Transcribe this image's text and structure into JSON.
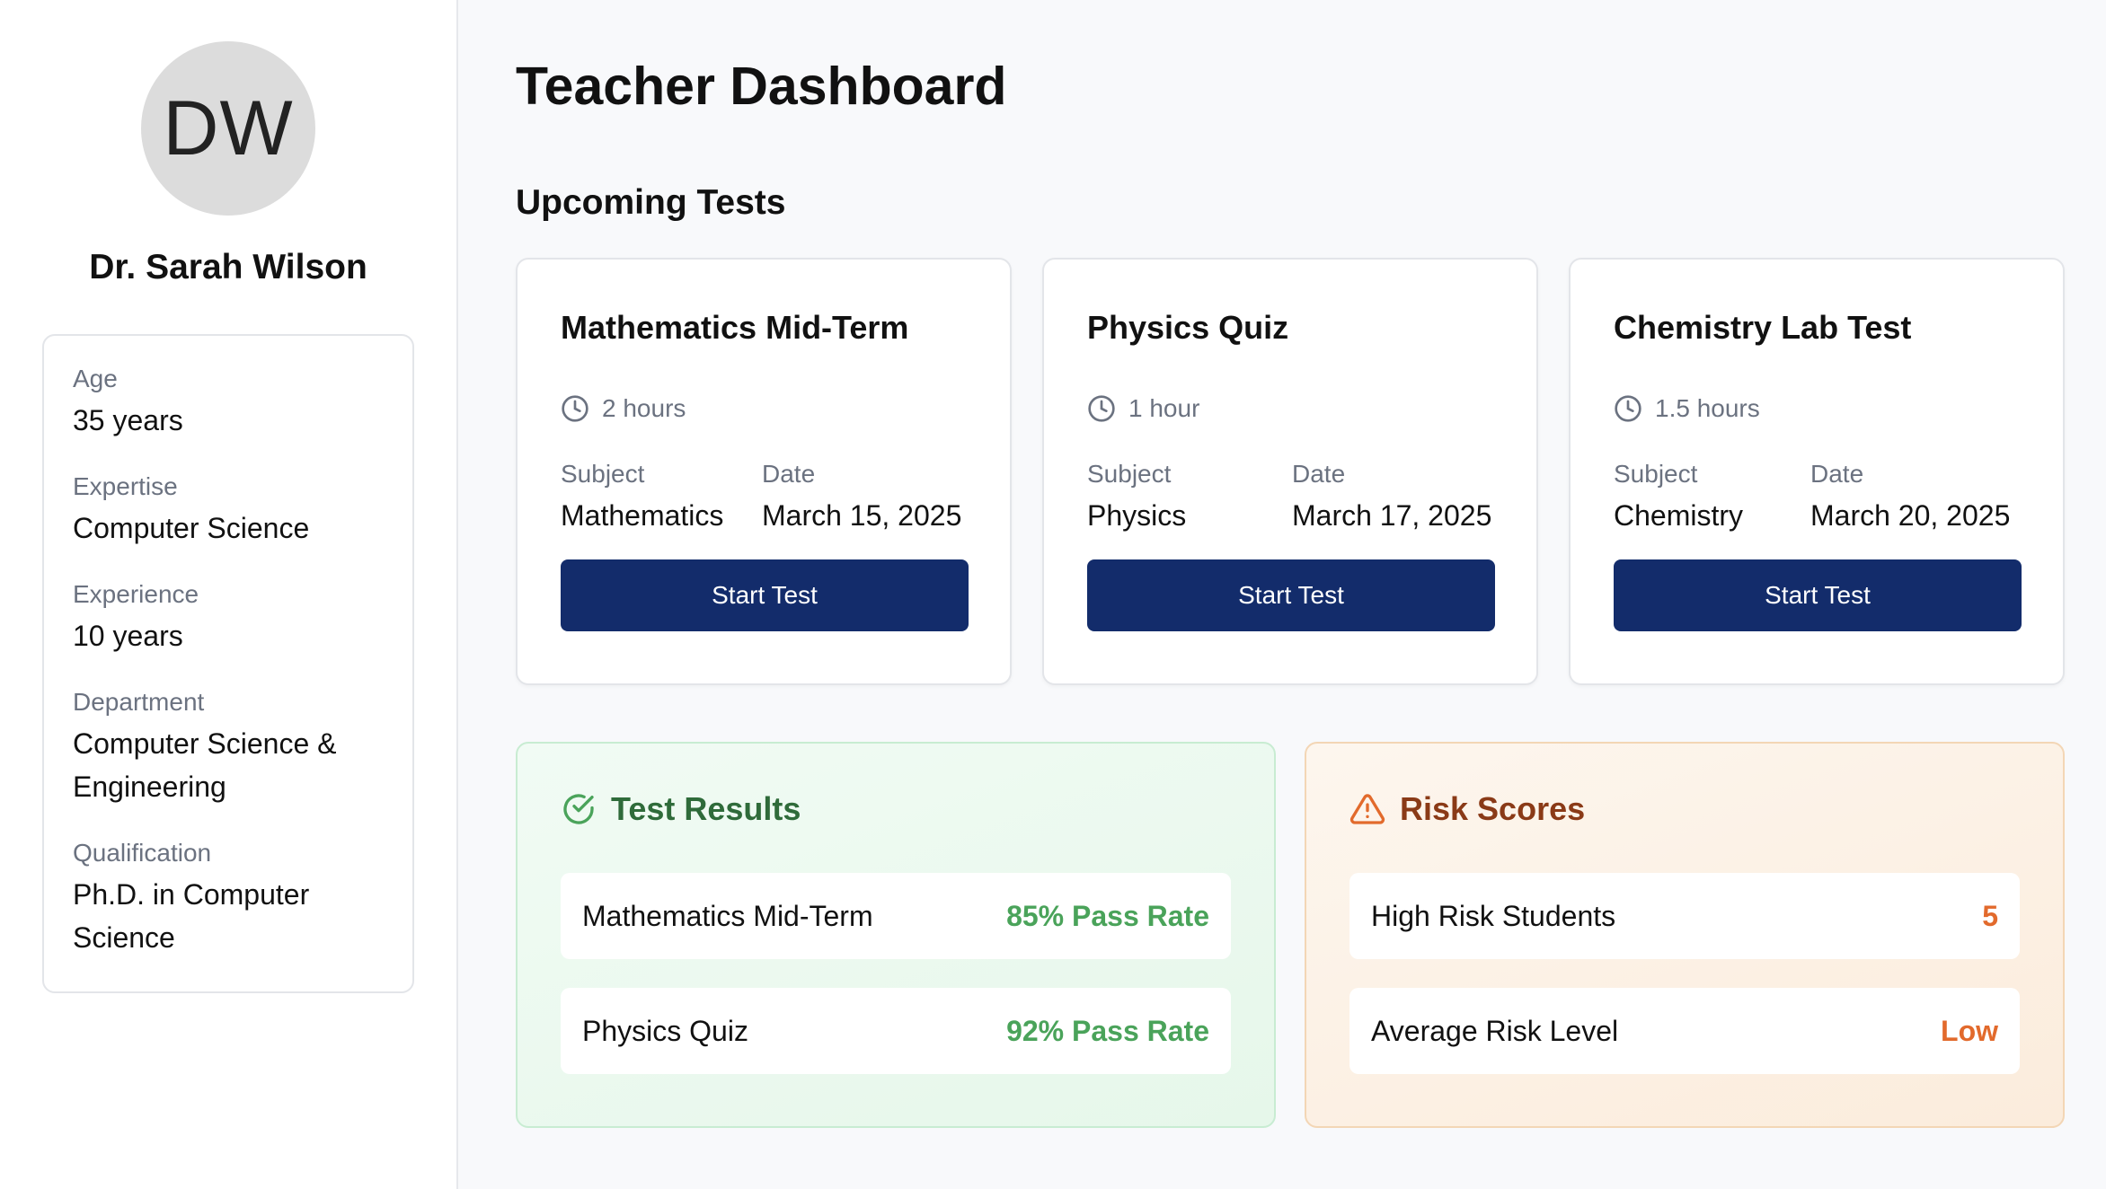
{
  "profile": {
    "initials": "DW",
    "name": "Dr. Sarah Wilson",
    "fields": [
      {
        "label": "Age",
        "value": "35 years"
      },
      {
        "label": "Expertise",
        "value": "Computer Science"
      },
      {
        "label": "Experience",
        "value": "10 years"
      },
      {
        "label": "Department",
        "value": "Computer Science & Engineering"
      },
      {
        "label": "Qualification",
        "value": "Ph.D. in Computer Science"
      }
    ]
  },
  "main": {
    "title": "Teacher Dashboard",
    "upcoming_title": "Upcoming Tests",
    "tests": [
      {
        "name": "Mathematics Mid-Term",
        "duration": "2 hours",
        "subject_label": "Subject",
        "subject": "Mathematics",
        "date_label": "Date",
        "date": "March 15, 2025",
        "button": "Start Test"
      },
      {
        "name": "Physics Quiz",
        "duration": "1 hour",
        "subject_label": "Subject",
        "subject": "Physics",
        "date_label": "Date",
        "date": "March 17, 2025",
        "button": "Start Test"
      },
      {
        "name": "Chemistry Lab Test",
        "duration": "1.5 hours",
        "subject_label": "Subject",
        "subject": "Chemistry",
        "date_label": "Date",
        "date": "March 20, 2025",
        "button": "Start Test"
      }
    ],
    "results": {
      "title": "Test Results",
      "icon": "check-circle-icon",
      "rows": [
        {
          "label": "Mathematics Mid-Term",
          "value": "85% Pass Rate"
        },
        {
          "label": "Physics Quiz",
          "value": "92% Pass Rate"
        }
      ]
    },
    "risk": {
      "title": "Risk Scores",
      "icon": "warning-triangle-icon",
      "rows": [
        {
          "label": "High Risk Students",
          "value": "5"
        },
        {
          "label": "Average Risk Level",
          "value": "Low"
        }
      ]
    }
  },
  "colors": {
    "button_bg": "#132c6b",
    "results_accent": "#4aa35a",
    "risk_accent": "#e26a2c"
  }
}
